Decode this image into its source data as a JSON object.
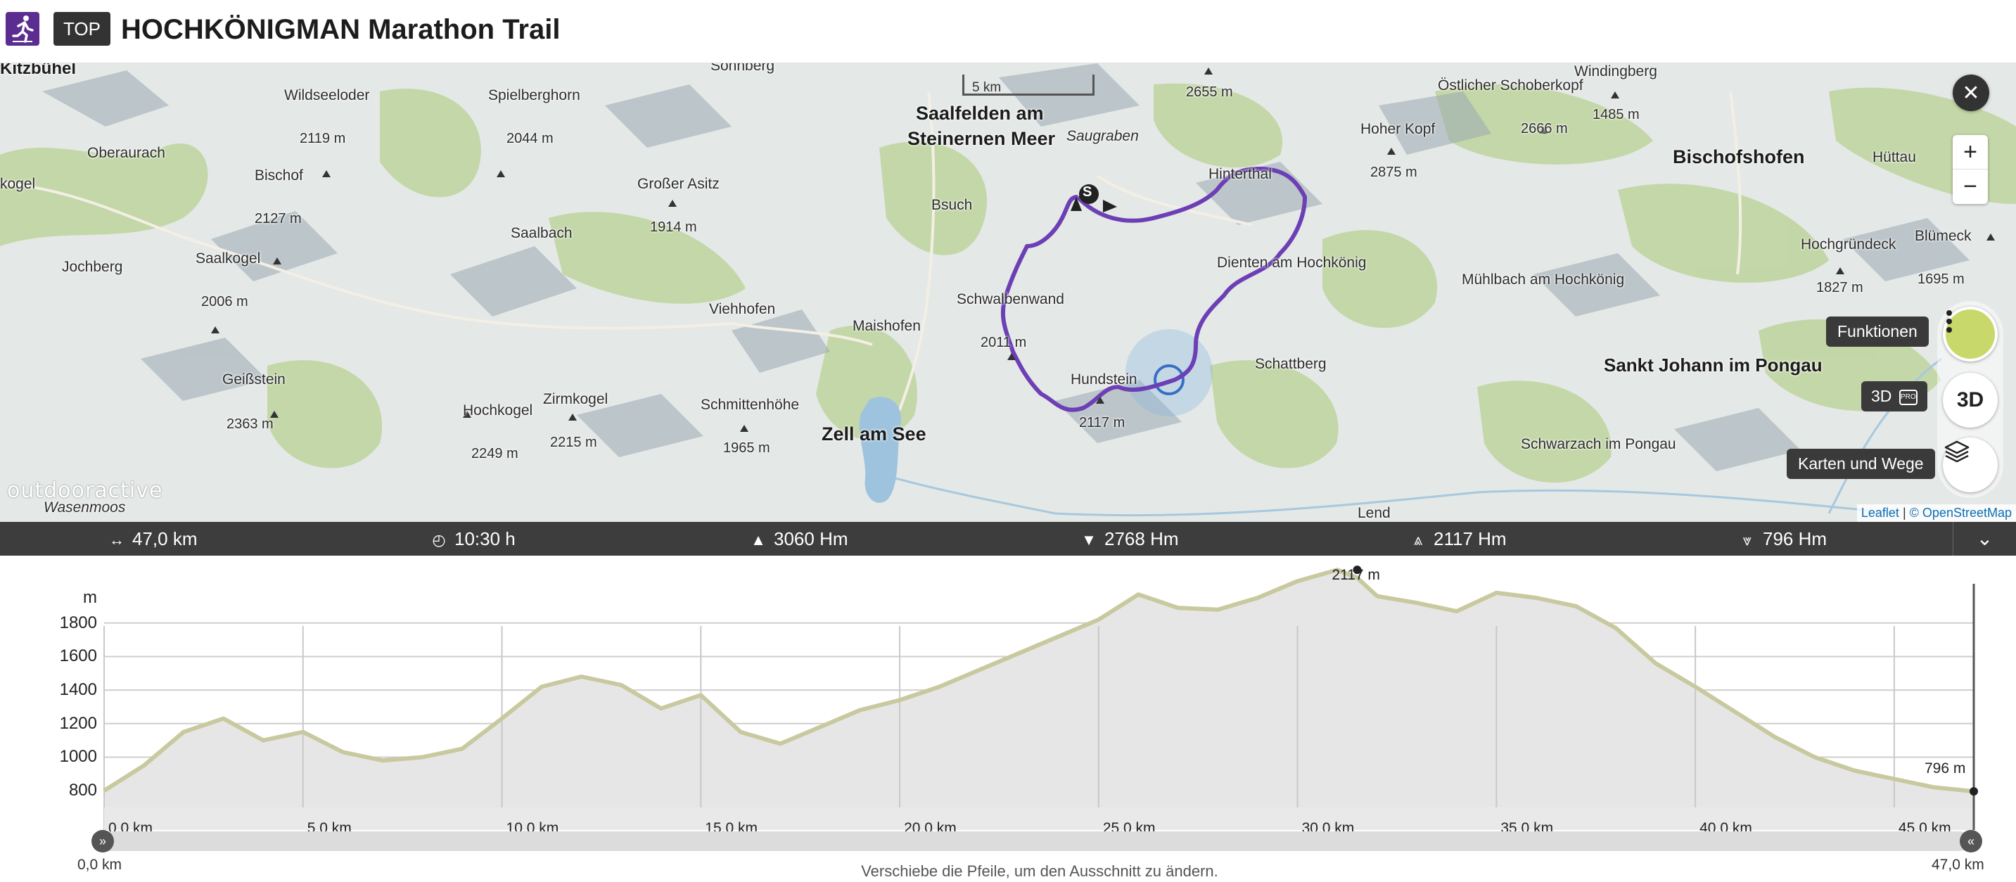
{
  "header": {
    "activity_icon": "running-person-icon",
    "badge": "TOP",
    "title": "HOCHKÖNIGMAN Marathon Trail"
  },
  "map": {
    "watermark": "outdooractive",
    "scale": "5 km",
    "attribution": {
      "leaflet": "Leaflet",
      "separator": "|",
      "osm": "© OpenStreetMap"
    },
    "controls": {
      "close_icon": "close-icon",
      "zoom_in": "+",
      "zoom_out": "−",
      "functions_label": "Funktionen",
      "threed_label": "3D",
      "threed_tip": "3D",
      "layers_label": "Karten und Wege"
    },
    "start_marker": "S",
    "labels": {
      "kitzbuhel": "Kitzbühel",
      "sonnberg": "Sonnberg",
      "wildseeloder": "Wildseeloder",
      "wildseeloder_h": "2119 m",
      "spielberghorn": "Spielberghorn",
      "spielberghorn_h": "2044 m",
      "oberaurach": "Oberaurach",
      "bischof": "Bischof",
      "bischof_h": "2127 m",
      "kogel": "kogel",
      "grosser_asitz": "Großer Asitz",
      "grosser_asitz_h": "1914 m",
      "saalbach": "Saalbach",
      "jochberg": "Jochberg",
      "saalkogel": "Saalkogel",
      "saalkogel_h": "2006 m",
      "viehhofen": "Viehhofen",
      "maishofen": "Maishofen",
      "geissstein": "Geißstein",
      "geissstein_h": "2363 m",
      "hochkogel": "Hochkogel",
      "hochkogel_h": "2249 m",
      "zirmkogel": "Zirmkogel",
      "zirmkogel_h": "2215 m",
      "schmittenhoehe": "Schmittenhöhe",
      "schmittenhoehe_h": "1965 m",
      "zell_am_see": "Zell am See",
      "wasenmoos": "Wasenmoos",
      "saalfelden": "Saalfelden am",
      "steinernen_meer": "Steinernen Meer",
      "bsuch": "Bsuch",
      "saugraben": "Saugraben",
      "schwalbenwand": "Schwalbenwand",
      "schwalbenwand_h": "2011 m",
      "hundstein": "Hundstein",
      "hundstein_h": "2117 m",
      "peak_2655": "2655 m",
      "hinterthal": "Hinterthal",
      "dienten": "Dienten am Hochkönig",
      "schattberg": "Schattberg",
      "hoher_kopf": "Hoher Kopf",
      "hoher_kopf_h": "2875 m",
      "schoberkopf": "Östlicher Schoberkopf",
      "schoberkopf_h": "2666 m",
      "windingberg": "Windingberg",
      "windingberg_h": "1485 m",
      "bischofshofen": "Bischofshofen",
      "huettau": "Hüttau",
      "muehlbach": "Mühlbach am Hochkönig",
      "hochgruendeck": "Hochgründeck",
      "hochgruendeck_h": "1827 m",
      "bluemeck": "Blümeck",
      "bluemeck_h": "1695 m",
      "sankt_johann": "Sankt Johann im Pongau",
      "schwarzach": "Schwarzach im Pongau",
      "lend": "Lend"
    }
  },
  "stats": {
    "distance": {
      "icon": "distance-icon",
      "value": "47,0 km"
    },
    "duration": {
      "icon": "clock-icon",
      "value": "10:30 h"
    },
    "ascent": {
      "icon": "ascent-icon",
      "value": "3060 Hm"
    },
    "descent": {
      "icon": "descent-icon",
      "value": "2768 Hm"
    },
    "highest": {
      "icon": "highest-point-icon",
      "value": "2117 Hm"
    },
    "lowest": {
      "icon": "lowest-point-icon",
      "value": "796 Hm"
    },
    "collapse_icon": "chevron-down-icon"
  },
  "chart_data": {
    "type": "area",
    "title": "",
    "xlabel": "",
    "ylabel": "m",
    "x_unit": "km",
    "ylim": [
      700,
      1950
    ],
    "xlim": [
      0,
      47
    ],
    "yticks": [
      "1800",
      "1600",
      "1400",
      "1200",
      "1000",
      "800"
    ],
    "xticks": [
      "0,0 km",
      "5,0 km",
      "10,0 km",
      "15,0 km",
      "20,0 km",
      "25,0 km",
      "30,0 km",
      "35,0 km",
      "40,0 km",
      "45,0 km"
    ],
    "series": [
      {
        "x": [
          0,
          1,
          2,
          3,
          4,
          5,
          6,
          7,
          8,
          9,
          10,
          11,
          12,
          13,
          14,
          15,
          16,
          17,
          18,
          19,
          20,
          21,
          22,
          23,
          24,
          25,
          26,
          27,
          28,
          29,
          30,
          31,
          31.5,
          32,
          33,
          34,
          35,
          36,
          37,
          38,
          39,
          40,
          41,
          42,
          43,
          44,
          45,
          46,
          47
        ],
        "y": [
          800,
          950,
          1150,
          1230,
          1100,
          1150,
          1030,
          980,
          1000,
          1050,
          1230,
          1420,
          1480,
          1430,
          1290,
          1370,
          1150,
          1080,
          1180,
          1280,
          1340,
          1420,
          1520,
          1620,
          1720,
          1820,
          1970,
          1890,
          1880,
          1950,
          2050,
          2117,
          2070,
          1960,
          1920,
          1870,
          1980,
          1950,
          1900,
          1770,
          1560,
          1420,
          1270,
          1120,
          1000,
          920,
          870,
          820,
          796
        ]
      }
    ],
    "annotations": [
      {
        "label": "2117 m",
        "x": 31.5,
        "y": 2117
      },
      {
        "label": "796 m",
        "x": 47,
        "y": 796
      }
    ],
    "range_start": "0,0 km",
    "range_end": "47,0 km",
    "hint": "Verschiebe die Pfeile, um den Ausschnitt zu ändern."
  }
}
